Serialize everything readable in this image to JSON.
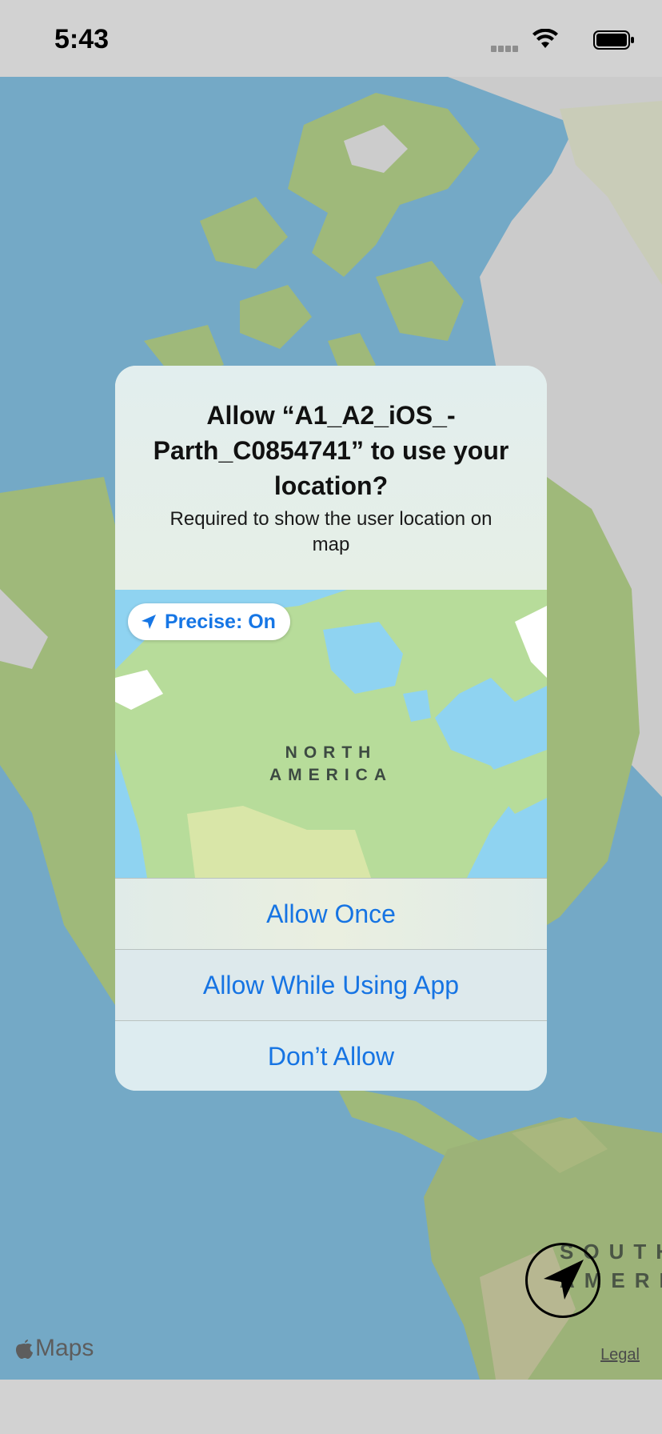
{
  "status_bar": {
    "time": "5:43",
    "icons": [
      "signal-icon",
      "wifi-icon",
      "battery-icon"
    ]
  },
  "map": {
    "branding": "Maps",
    "legal_link": "Legal",
    "region_label": "SOUTH AMERICA",
    "region_label_lines": [
      "SOUTH",
      "AMERIC"
    ],
    "compass_icon": "location-arrow-icon",
    "colors": {
      "ocean": "#74a9c6",
      "land": "#9fb97a",
      "ice": "#cfcfcf"
    }
  },
  "alert": {
    "title": "Allow “A1_A2_iOS_-Parth_C0854741” to use your location?",
    "message": "Required to show the user location on map",
    "precise_toggle": "Precise: On",
    "map_label_lines": [
      "NORTH",
      "AMERICA"
    ],
    "buttons": {
      "allow_once": "Allow Once",
      "allow_while_using": "Allow While Using App",
      "dont_allow": "Don’t Allow"
    },
    "accent_color": "#1674e3"
  }
}
